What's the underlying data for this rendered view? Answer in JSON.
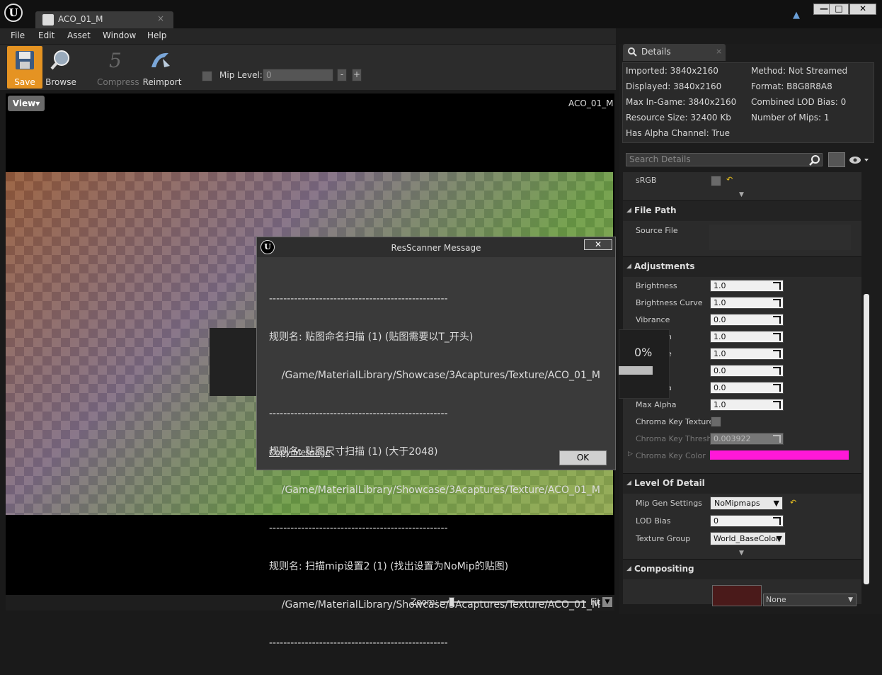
{
  "window": {
    "tab_title": "ACO_01_M",
    "tab_close": "×",
    "logo": "U",
    "minimize": "—",
    "maximize": "□",
    "close": "✕"
  },
  "menu": [
    "File",
    "Edit",
    "Asset",
    "Window",
    "Help"
  ],
  "toolbar": {
    "save": "Save",
    "browse": "Browse",
    "compress": "Compress",
    "reimport": "Reimport",
    "mip_level_label": "Mip Level:",
    "mip_level_value": "0",
    "minus": "-",
    "plus": "+"
  },
  "viewport": {
    "view_button": "View▾",
    "title": "ACO_01_M",
    "zoom_label": "Zoom:",
    "zoom_mode": "Fit",
    "zoom_dropdown": "▼"
  },
  "progress": {
    "percent": "0%"
  },
  "dialog": {
    "title": "ResScanner Message",
    "close": "✕",
    "logo": "U",
    "lines": [
      "--------------------------------------------------",
      "规则名: 贴图命名扫描 (1) (贴图需要以T_开头)",
      "    /Game/MaterialLibrary/Showcase/3Acaptures/Texture/ACO_01_M",
      "--------------------------------------------------",
      "规则名: 贴图尺寸扫描 (1) (大于2048)",
      "    /Game/MaterialLibrary/Showcase/3Acaptures/Texture/ACO_01_M",
      "--------------------------------------------------",
      "规则名: 扫描mip设置2 (1) (找出设置为NoMip的贴图)",
      "    /Game/MaterialLibrary/Showcase/3Acaptures/Texture/ACO_01_M",
      "--------------------------------------------------"
    ],
    "copy_message": "Copy Message",
    "ok": "OK"
  },
  "details": {
    "tab_label": "Details",
    "tab_close": "×",
    "info": {
      "imported": "Imported: 3840x2160",
      "displayed": "Displayed: 3840x2160",
      "max_in_game": "Max In-Game: 3840x2160",
      "resource_size": "Resource Size: 32400 Kb",
      "has_alpha": "Has Alpha Channel: True",
      "method": "Method: Not Streamed",
      "format": "Format: B8G8R8A8",
      "lod_bias": "Combined LOD Bias: 0",
      "num_mips": "Number of Mips: 1"
    },
    "search_placeholder": "Search Details",
    "srgb_label": "sRGB",
    "file_path_category": "File Path",
    "source_file_label": "Source File",
    "adjustments_category": "Adjustments",
    "adjustments": [
      {
        "label": "Brightness",
        "value": "1.0"
      },
      {
        "label": "Brightness Curve",
        "value": "1.0"
      },
      {
        "label": "Vibrance",
        "value": "0.0"
      },
      {
        "label": "n",
        "value": "1.0"
      },
      {
        "label": "e",
        "value": "1.0"
      },
      {
        "label": "",
        "value": "0.0"
      },
      {
        "label": "a",
        "value": "0.0"
      },
      {
        "label": "Max Alpha",
        "value": "1.0"
      }
    ],
    "chroma_key_texture": "Chroma Key Texture",
    "chroma_key_threshold_label": "Chroma Key Thresho",
    "chroma_key_threshold_value": "0.003922",
    "chroma_key_color_label": "Chroma Key Color",
    "chroma_key_color": "#ff18d8",
    "lod_category": "Level Of Detail",
    "mip_gen_label": "Mip Gen Settings",
    "mip_gen_value": "NoMipmaps",
    "lod_bias_label": "LOD Bias",
    "lod_bias_value": "0",
    "texture_group_label": "Texture Group",
    "texture_group_value": "World_BaseColor",
    "compositing_category": "Compositing",
    "compositing_value": "None"
  },
  "colors": {
    "accent_save": "#e59322",
    "chroma_key": "#ff18d8"
  }
}
